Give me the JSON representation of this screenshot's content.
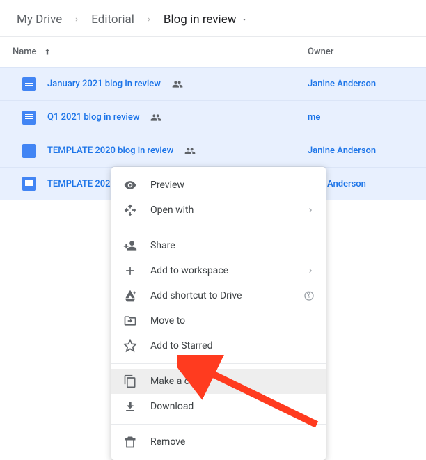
{
  "breadcrumbs": {
    "root": "My Drive",
    "mid": "Editorial",
    "current": "Blog in review"
  },
  "columns": {
    "name": "Name",
    "owner": "Owner"
  },
  "rows": [
    {
      "name": "January 2021 blog in review",
      "owner": "Janine Anderson"
    },
    {
      "name": "Q1 2021 blog in review",
      "owner": "me"
    },
    {
      "name": "TEMPLATE 2020 blog in review",
      "owner": "Janine Anderson"
    },
    {
      "name": "TEMPLATE 202",
      "owner": "nine Anderson"
    }
  ],
  "menu": {
    "preview": "Preview",
    "openwith": "Open with",
    "share": "Share",
    "addworkspace": "Add to workspace",
    "addshortcut": "Add shortcut to Drive",
    "moveto": "Move to",
    "addstarred": "Add to Starred",
    "makecopy": "Make a copy",
    "download": "Download",
    "remove": "Remove"
  }
}
